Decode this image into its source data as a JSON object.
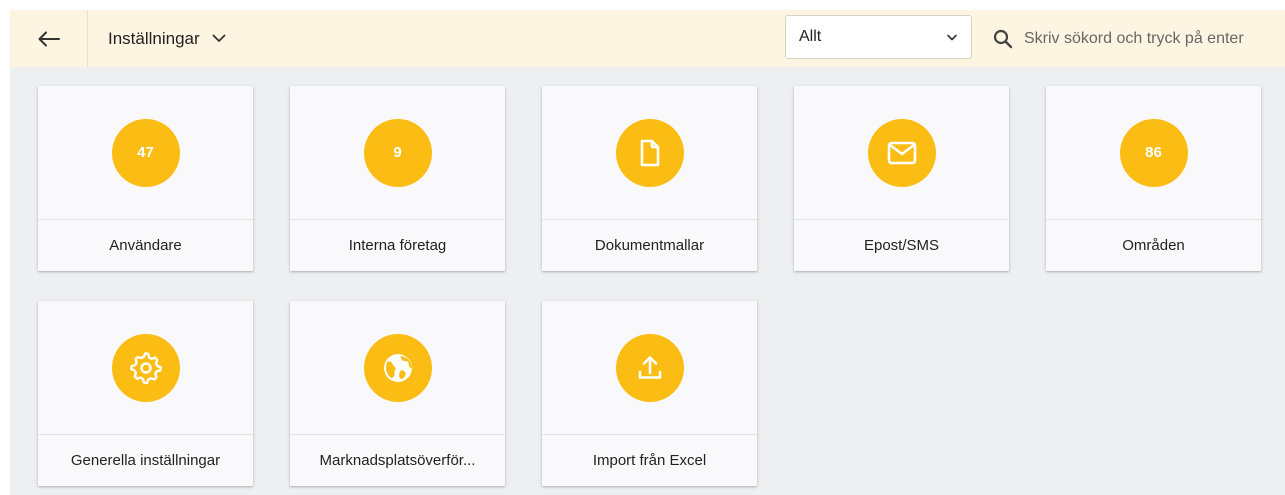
{
  "header": {
    "title": "Inställningar",
    "filter_value": "Allt",
    "search_placeholder": "Skriv sökord och tryck på enter"
  },
  "colors": {
    "header_bg": "#fdf5e2",
    "accent": "#fbbc14",
    "content_bg": "#eeeff1"
  },
  "cards": [
    {
      "label": "Användare",
      "badge": "47",
      "icon": "count-badge"
    },
    {
      "label": "Interna företag",
      "badge": "9",
      "icon": "count-badge"
    },
    {
      "label": "Dokumentmallar",
      "icon": "document-icon"
    },
    {
      "label": "Epost/SMS",
      "icon": "envelope-icon"
    },
    {
      "label": "Områden",
      "badge": "86",
      "icon": "count-badge"
    },
    {
      "label": "Generella inställningar",
      "icon": "gear-icon"
    },
    {
      "label": "Marknadsplatsöverför...",
      "icon": "globe-icon"
    },
    {
      "label": "Import från Excel",
      "icon": "upload-icon"
    }
  ]
}
